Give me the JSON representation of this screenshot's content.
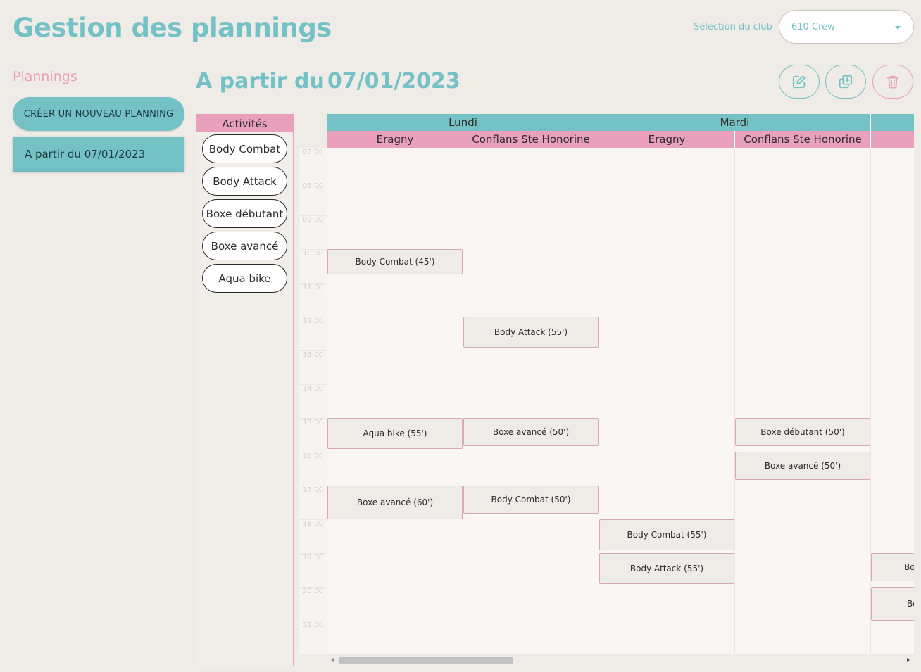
{
  "header": {
    "title": "Gestion des plannings",
    "club_label": "Sélection du club",
    "club_value": "610 Crew"
  },
  "sidebar": {
    "title": "Plannings",
    "create_button": "CRÉER UN NOUVEAU PLANNING",
    "items": [
      {
        "label": "A partir du 07/01/2023"
      }
    ]
  },
  "main": {
    "title_prefix": "A partir du",
    "title_date": "07/01/2023",
    "actions": [
      "edit-icon",
      "duplicate-icon",
      "trash-icon"
    ]
  },
  "activities": {
    "header": "Activités",
    "items": [
      "Body Combat",
      "Body Attack",
      "Boxe débutant",
      "Boxe avancé",
      "Aqua bike"
    ]
  },
  "schedule": {
    "times": [
      "07:00",
      "08:00",
      "09:00",
      "10:00",
      "11:00",
      "12:00",
      "13:00",
      "14:00",
      "15:00",
      "16:00",
      "17:00",
      "18:00",
      "19:00",
      "20:00",
      "21:00"
    ],
    "days": [
      {
        "name": "Lundi",
        "locations": [
          "Eragny",
          "Conflans Ste Honorine"
        ]
      },
      {
        "name": "Mardi",
        "locations": [
          "Eragny",
          "Conflans Ste Honorine"
        ]
      }
    ],
    "events": [
      {
        "label": "Body Combat (45')"
      },
      {
        "label": "Aqua bike (55')"
      },
      {
        "label": "Boxe avancé (60')"
      },
      {
        "label": "Body Attack (55')"
      },
      {
        "label": "Boxe avancé (50')"
      },
      {
        "label": "Body Combat (50')"
      },
      {
        "label": "Body Combat (55')"
      },
      {
        "label": "Body Attack (55')"
      },
      {
        "label": "Boxe débutant (50')"
      },
      {
        "label": "Boxe avancé (50')"
      },
      {
        "label": "Bo"
      },
      {
        "label": "Bo"
      }
    ]
  },
  "colors": {
    "teal": "#74c2c6",
    "pink": "#e9a0bc",
    "background": "#efebe6"
  }
}
